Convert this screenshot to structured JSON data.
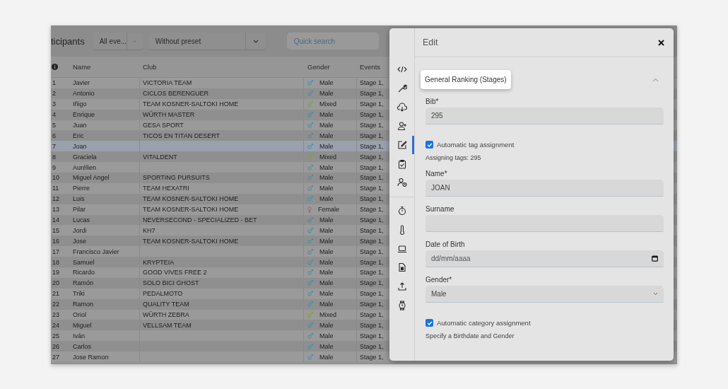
{
  "toolbar": {
    "title": "ticipants",
    "event_filter": "All eve...",
    "preset": "Without preset",
    "search": {
      "placeholder": "Quick search"
    }
  },
  "table": {
    "columns": [
      "Name",
      "Club",
      "Gender",
      "Events"
    ],
    "rows": [
      {
        "num": "1",
        "name": "Javier",
        "club": "VICTORIA TEAM",
        "gender": "Male",
        "kind": "male",
        "events": "Stage 1,",
        "selected": false
      },
      {
        "num": "2",
        "name": "Antonio",
        "club": "CICLOS BERENGUER",
        "gender": "Male",
        "kind": "male",
        "events": "Stage 1,",
        "selected": false
      },
      {
        "num": "3",
        "name": "Iñigo",
        "club": "TEAM KOSNER-SALTOKI HOME",
        "gender": "Mixed",
        "kind": "mixed",
        "events": "Stage 1,",
        "selected": false
      },
      {
        "num": "4",
        "name": "Enrique",
        "club": "WÜRTH MASTER",
        "gender": "Male",
        "kind": "male",
        "events": "Stage 1,",
        "selected": false
      },
      {
        "num": "5",
        "name": "Juan",
        "club": "GESA SPORT",
        "gender": "Male",
        "kind": "male",
        "events": "Stage 1,",
        "selected": false
      },
      {
        "num": "6",
        "name": "Eric",
        "club": "TICOS EN TITAN DESERT",
        "gender": "Male",
        "kind": "male",
        "events": "Stage 1,",
        "selected": false
      },
      {
        "num": "7",
        "name": "Joan",
        "club": "",
        "gender": "Male",
        "kind": "male",
        "events": "Stage 1,",
        "selected": true
      },
      {
        "num": "8",
        "name": "Graciela",
        "club": "VITALDENT",
        "gender": "Mixed",
        "kind": "mixed",
        "events": "Stage 1,",
        "selected": false
      },
      {
        "num": "9",
        "name": "Aurélien",
        "club": "",
        "gender": "Male",
        "kind": "male",
        "events": "Stage 1,",
        "selected": false
      },
      {
        "num": "10",
        "name": "Miguel Angel",
        "club": "SPORTING PURSUITS",
        "gender": "Male",
        "kind": "male",
        "events": "Stage 1,",
        "selected": false
      },
      {
        "num": "11",
        "name": "Pierre",
        "club": "TEAM HEXATRI",
        "gender": "Male",
        "kind": "male",
        "events": "Stage 1,",
        "selected": false
      },
      {
        "num": "12",
        "name": "Luis",
        "club": "TEAM KOSNER-SALTOKI HOME",
        "gender": "Male",
        "kind": "male",
        "events": "Stage 1,",
        "selected": false
      },
      {
        "num": "13",
        "name": "Pilar",
        "club": "TEAM KOSNER-SALTOKI HOME",
        "gender": "Female",
        "kind": "female",
        "events": "Stage 1,",
        "selected": false
      },
      {
        "num": "14",
        "name": "Lucas",
        "club": "NEVERSECOND - SPECIALIZED - BET",
        "gender": "Male",
        "kind": "male",
        "events": "Stage 1,",
        "selected": false
      },
      {
        "num": "15",
        "name": "Jordi",
        "club": "KH7",
        "gender": "Male",
        "kind": "male",
        "events": "Stage 1,",
        "selected": false
      },
      {
        "num": "16",
        "name": "Jose",
        "club": "TEAM KOSNER-SALTOKI HOME",
        "gender": "Male",
        "kind": "male",
        "events": "Stage 1,",
        "selected": false
      },
      {
        "num": "17",
        "name": "Francisco Javier",
        "club": "",
        "gender": "Male",
        "kind": "male",
        "events": "Stage 1,",
        "selected": false
      },
      {
        "num": "18",
        "name": "Samuel",
        "club": "KRYPTEIA",
        "gender": "Male",
        "kind": "male",
        "events": "Stage 1,",
        "selected": false
      },
      {
        "num": "19",
        "name": "Ricardo",
        "club": "GOOD VIVES FREE 2",
        "gender": "Male",
        "kind": "male",
        "events": "Stage 1,",
        "selected": false
      },
      {
        "num": "20",
        "name": "Ramón",
        "club": "SOLO BICI GHOST",
        "gender": "Male",
        "kind": "male",
        "events": "Stage 1,",
        "selected": false
      },
      {
        "num": "21",
        "name": "Triki",
        "club": "PEDALMOTO",
        "gender": "Male",
        "kind": "male",
        "events": "Stage 1,",
        "selected": false
      },
      {
        "num": "22",
        "name": "Ramon",
        "club": "QUALITY TEAM",
        "gender": "Male",
        "kind": "male",
        "events": "Stage 1,",
        "selected": false
      },
      {
        "num": "23",
        "name": "Oriol",
        "club": "WÜRTH ZEBRA",
        "gender": "Mixed",
        "kind": "mixed",
        "events": "Stage 1,",
        "selected": false
      },
      {
        "num": "24",
        "name": "Miguel",
        "club": "VELLSAM TEAM",
        "gender": "Male",
        "kind": "male",
        "events": "Stage 1,",
        "selected": false
      },
      {
        "num": "25",
        "name": "Iván",
        "club": "",
        "gender": "Male",
        "kind": "male",
        "events": "Stage 1,",
        "selected": false
      },
      {
        "num": "26",
        "name": "Carlos",
        "club": "",
        "gender": "Male",
        "kind": "male",
        "events": "Stage 1,",
        "selected": false
      },
      {
        "num": "27",
        "name": "Jose Ramon",
        "club": "",
        "gender": "Male",
        "kind": "male",
        "events": "Stage 1,",
        "selected": false
      }
    ]
  },
  "edit_panel": {
    "title": "Edit",
    "sidebar": {
      "groups": [
        [
          {
            "selected": false
          },
          {
            "selected": false
          },
          {
            "selected": false
          },
          {
            "selected": false
          },
          {
            "selected": true
          },
          {
            "selected": false
          },
          {
            "selected": false
          }
        ],
        [
          {
            "selected": false
          },
          {
            "selected": false
          },
          {
            "selected": false
          },
          {
            "selected": false
          },
          {
            "selected": false
          },
          {
            "selected": false
          }
        ]
      ]
    },
    "section": {
      "title": "General Ranking (Stages)",
      "expanded": true
    },
    "items": [
      {
        "kind": "field",
        "label": "Bib*",
        "value": "295"
      },
      {
        "kind": "checkbox",
        "label": "Automatic tag assignment",
        "checked": true,
        "hint": "Assigning tags: 295"
      },
      {
        "kind": "field",
        "label": "Name*",
        "value": "JOAN"
      },
      {
        "kind": "field",
        "label": "Surname",
        "value": ""
      },
      {
        "kind": "date",
        "label": "Date of Birth",
        "placeholder": "dd/mm/aaaa"
      },
      {
        "kind": "select",
        "label": "Gender*",
        "value": "Male"
      },
      {
        "kind": "checkbox",
        "label": "Automatic category assignment",
        "checked": true,
        "hint": "Specify a Birthdate and Gender"
      }
    ]
  }
}
